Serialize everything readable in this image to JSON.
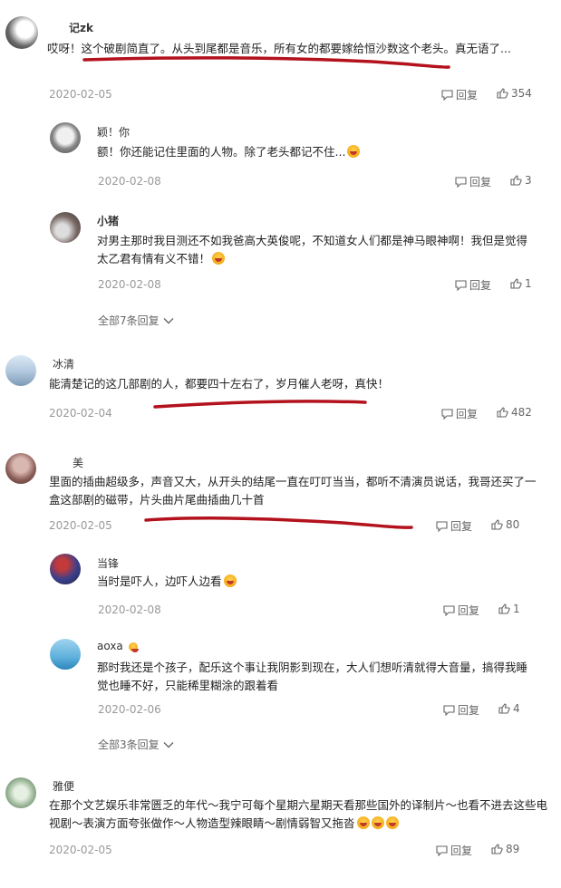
{
  "comments": [
    {
      "user": "记zk",
      "text": "哎呀！这个破剧简直了。从头到尾都是音乐，所有女的都要嫁给恒沙数这个老头。真无语了...",
      "date": "2020-02-05",
      "reply_label": "回复",
      "likes": "354"
    },
    {
      "user": "颖！你",
      "text": "额！你还能记住里面的人物。除了老头都记不住...",
      "date": "2020-02-08",
      "reply_label": "回复",
      "likes": "3"
    },
    {
      "user": "小猪",
      "text": "对男主那时我目测还不如我爸高大英俊呢，不知道女人们都是神马眼神啊！我但是觉得太乙君有情有义不错！",
      "date": "2020-02-08",
      "reply_label": "回复",
      "likes": "1"
    },
    {
      "user": "冰清",
      "text": "能清楚记的这几部剧的人，都要四十左右了，岁月催人老呀，真快！",
      "date": "2020-02-04",
      "reply_label": "回复",
      "likes": "482"
    },
    {
      "user": "美",
      "text": "里面的插曲超级多，声音又大，从开头的结尾一直在叮叮当当，都听不清演员说话，我哥还买了一盒这部剧的磁带，片头曲片尾曲插曲几十首",
      "date": "2020-02-05",
      "reply_label": "回复",
      "likes": "80"
    },
    {
      "user": "当锋",
      "text": "当时是吓人，边吓人边看",
      "date": "2020-02-08",
      "reply_label": "回复",
      "likes": "1"
    },
    {
      "user": "aoxa",
      "text": "那时我还是个孩子，配乐这个事让我阴影到现在，大人们想听清就得大音量，搞得我睡觉也睡不好，只能稀里糊涂的跟着看",
      "date": "2020-02-06",
      "reply_label": "回复",
      "likes": "4"
    },
    {
      "user": "雅便",
      "text": "在那个文艺娱乐非常匮乏的年代～我宁可每个星期六星期天看那些国外的译制片～也看不进去这些电视剧～表演方面夸张做作～人物造型辣眼睛～剧情弱智又拖沓",
      "date": "2020-02-05",
      "reply_label": "回复",
      "likes": "89"
    }
  ],
  "expand": [
    {
      "label": "全部7条回复"
    },
    {
      "label": "全部3条回复"
    }
  ],
  "colors": {
    "underline": "#b3121d",
    "text": "#222222",
    "meta": "#999999"
  }
}
